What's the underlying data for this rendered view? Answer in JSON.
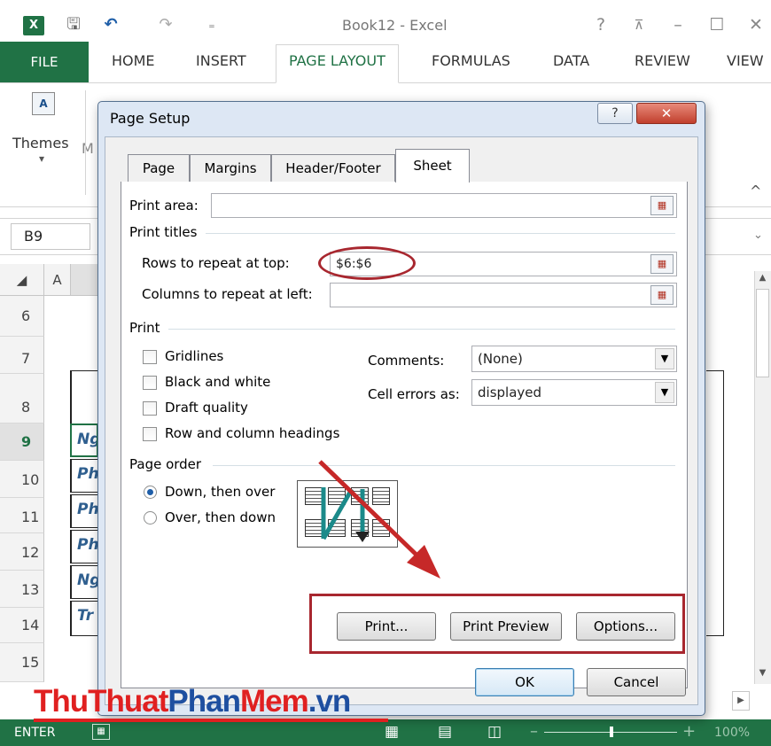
{
  "window": {
    "title": "Book12 - Excel",
    "logo": "X",
    "qa_icons": [
      "save-icon",
      "undo-icon",
      "redo-icon",
      "customize-icon"
    ],
    "controls": [
      "?",
      "⊼",
      "–",
      "☐",
      "✕"
    ]
  },
  "ribbon": {
    "tabs": [
      "FILE",
      "HOME",
      "INSERT",
      "PAGE LAYOUT",
      "FORMULAS",
      "DATA",
      "REVIEW",
      "VIEW"
    ],
    "active_tab": "PAGE LAYOUT",
    "themes_label": "Themes",
    "partial_label": "M",
    "collapse_icon": "^"
  },
  "namebox": "B9",
  "sheet": {
    "column_a": "A",
    "rows": [
      "6",
      "7",
      "8",
      "9",
      "10",
      "11",
      "12",
      "13",
      "14",
      "15"
    ],
    "selected_row": "9",
    "cells": [
      "Ng",
      "Ph",
      "Ph",
      "Ph",
      "Ng",
      "Tr"
    ]
  },
  "dialog": {
    "title": "Page Setup",
    "help": "?",
    "close": "✕",
    "tabs": [
      "Page",
      "Margins",
      "Header/Footer",
      "Sheet"
    ],
    "active_tab": "Sheet",
    "print_area_label": "Print area:",
    "print_area_value": "",
    "print_titles_label": "Print titles",
    "rows_repeat_label": "Rows to repeat at top:",
    "rows_repeat_value": "$6:$6",
    "cols_repeat_label": "Columns to repeat at left:",
    "cols_repeat_value": "",
    "print_section_label": "Print",
    "checkboxes": [
      {
        "label": "Gridlines",
        "checked": false
      },
      {
        "label": "Black and white",
        "checked": false
      },
      {
        "label": "Draft quality",
        "checked": false
      },
      {
        "label": "Row and column headings",
        "checked": false
      }
    ],
    "comments_label": "Comments:",
    "comments_value": "(None)",
    "cell_errors_label": "Cell errors as:",
    "cell_errors_value": "displayed",
    "page_order_label": "Page order",
    "radios": [
      {
        "label": "Down, then over",
        "selected": true
      },
      {
        "label": "Over, then down",
        "selected": false
      }
    ],
    "buttons": {
      "print": "Print...",
      "print_preview": "Print Preview",
      "options": "Options...",
      "ok": "OK",
      "cancel": "Cancel"
    }
  },
  "status": {
    "mode": "ENTER",
    "zoom": "100%"
  },
  "watermark": {
    "part1": "Thu",
    "part2": "Thuat",
    "part3": "Phan",
    "part4": "Mem",
    "part5": ".vn"
  },
  "colors": {
    "excel_green": "#207245",
    "annotation_red": "#a8272f",
    "dialog_frame": "#dde7f4"
  }
}
